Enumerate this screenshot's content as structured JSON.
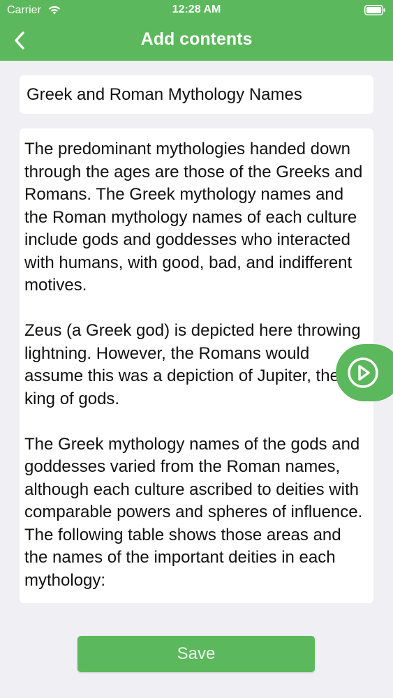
{
  "status_bar": {
    "carrier": "Carrier",
    "time": "12:28 AM"
  },
  "header": {
    "title": "Add contents",
    "back_icon": "chevron-left-icon"
  },
  "form": {
    "title_value": "Greek and Roman Mythology Names",
    "content_value": "The predominant mythologies handed down through the ages are those of the Greeks and Romans. The Greek mythology names and the Roman mythology names of each culture include gods and goddesses who interacted with humans, with good, bad, and indifferent motives.\n\nZeus (a Greek god) is depicted here throwing lightning. However, the Romans would assume this was a depiction of Jupiter, the king of gods.\n\nThe Greek mythology names of the gods and goddesses varied from the Roman names, although each culture ascribed to deities with comparable powers and spheres of influence. The following table shows those areas and the names of the important deities in each mythology:",
    "save_label": "Save"
  },
  "play_button": {
    "icon": "play-circle-icon"
  },
  "colors": {
    "accent": "#5cb85c",
    "background": "#f0eff4"
  }
}
